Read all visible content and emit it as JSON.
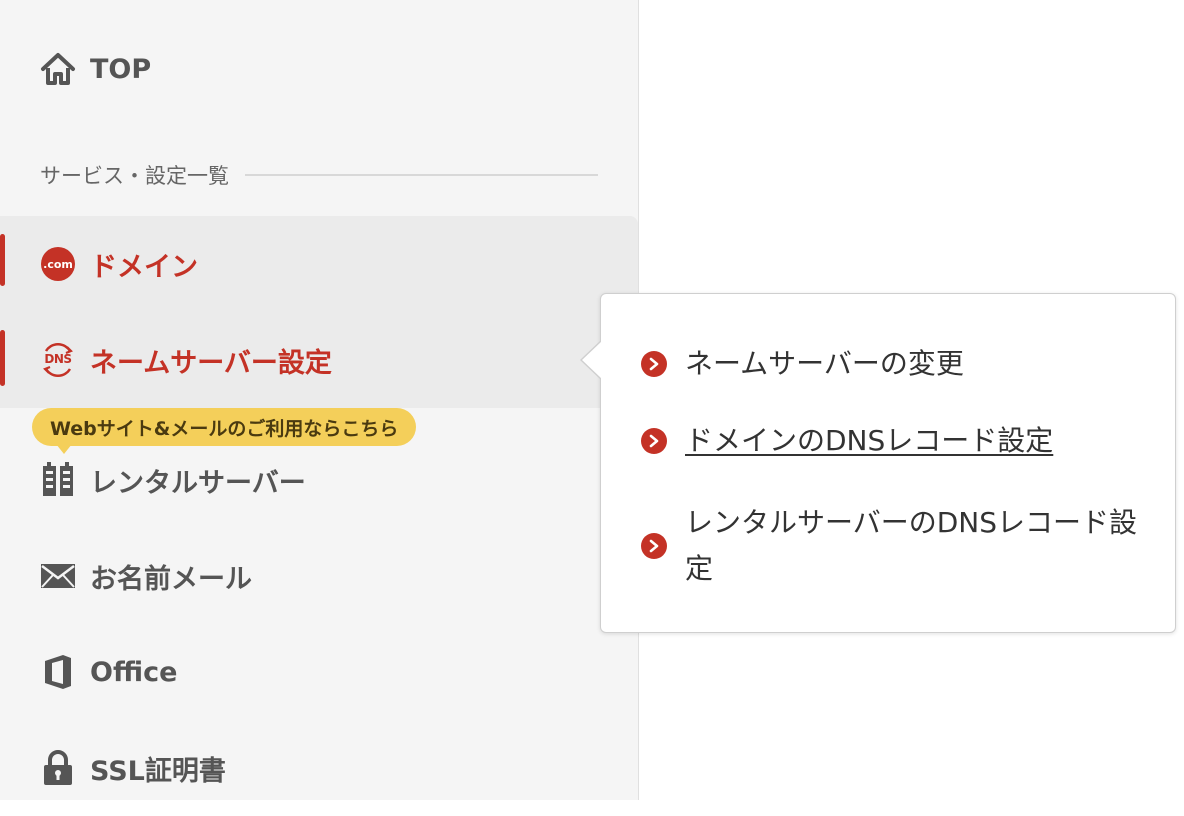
{
  "sidebar": {
    "top": {
      "label": "TOP",
      "icon": "home-icon"
    },
    "section_heading": "サービス・設定一覧",
    "items": [
      {
        "key": "domain",
        "label": "ドメイン",
        "icon": "dot-com-icon",
        "icon_text": ".com",
        "active": true
      },
      {
        "key": "nameserver",
        "label": "ネームサーバー設定",
        "icon": "dns-icon",
        "icon_text": "DNS",
        "active": true
      },
      {
        "key": "rental",
        "label": "レンタルサーバー",
        "icon": "server-icon"
      },
      {
        "key": "mail",
        "label": "お名前メール",
        "icon": "envelope-icon"
      },
      {
        "key": "office",
        "label": "Office",
        "icon": "office-icon"
      },
      {
        "key": "ssl",
        "label": "SSL証明書",
        "icon": "lock-icon"
      }
    ],
    "rental_badge": "Webサイト&メールのご利用ならこちら"
  },
  "popover": {
    "links": [
      {
        "label": "ネームサーバーの変更"
      },
      {
        "label": "ドメインのDNSレコード設定",
        "hovered": true
      },
      {
        "label": "レンタルサーバーのDNSレコード設定"
      }
    ]
  },
  "colors": {
    "accent": "#c43226",
    "badge": "#f4cf5a",
    "sidebar_bg": "#f5f5f5",
    "active_bg": "#ebebeb"
  }
}
